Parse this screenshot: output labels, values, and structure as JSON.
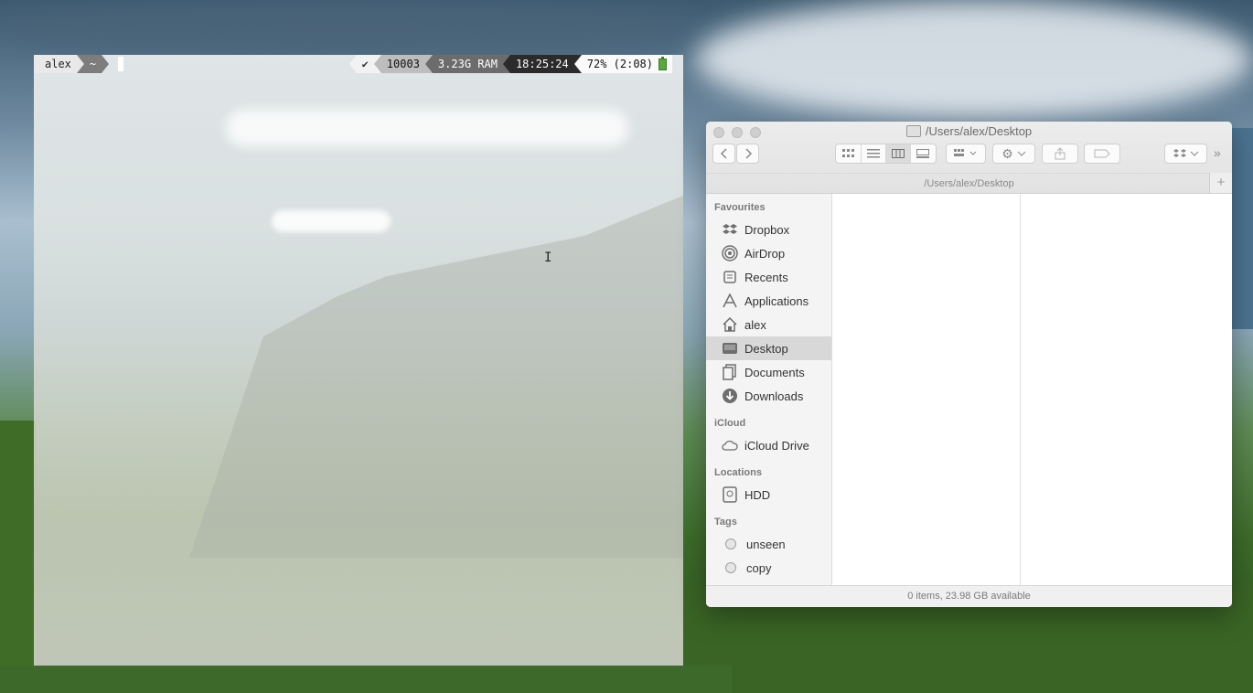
{
  "terminal": {
    "prompt_user": "alex",
    "prompt_dir": "~",
    "status_check": "✔",
    "history_number": "10003",
    "ram": "3.23G RAM",
    "time": "18:25:24",
    "battery": "72% (2:08)"
  },
  "finder": {
    "window_title": "/Users/alex/Desktop",
    "path_bar": "/Users/alex/Desktop",
    "status_text": "0 items, 23.98 GB available",
    "sidebar": {
      "favourites_header": "Favourites",
      "favourites": [
        {
          "label": "Dropbox",
          "icon": "dropbox-icon"
        },
        {
          "label": "AirDrop",
          "icon": "airdrop-icon"
        },
        {
          "label": "Recents",
          "icon": "recents-icon"
        },
        {
          "label": "Applications",
          "icon": "applications-icon"
        },
        {
          "label": "alex",
          "icon": "home-icon"
        },
        {
          "label": "Desktop",
          "icon": "desktop-icon"
        },
        {
          "label": "Documents",
          "icon": "documents-icon"
        },
        {
          "label": "Downloads",
          "icon": "downloads-icon"
        }
      ],
      "icloud_header": "iCloud",
      "icloud": [
        {
          "label": "iCloud Drive",
          "icon": "cloud-icon"
        }
      ],
      "locations_header": "Locations",
      "locations": [
        {
          "label": "HDD",
          "icon": "disk-icon"
        }
      ],
      "tags_header": "Tags",
      "tags": [
        {
          "label": "unseen"
        },
        {
          "label": "copy"
        }
      ]
    }
  }
}
